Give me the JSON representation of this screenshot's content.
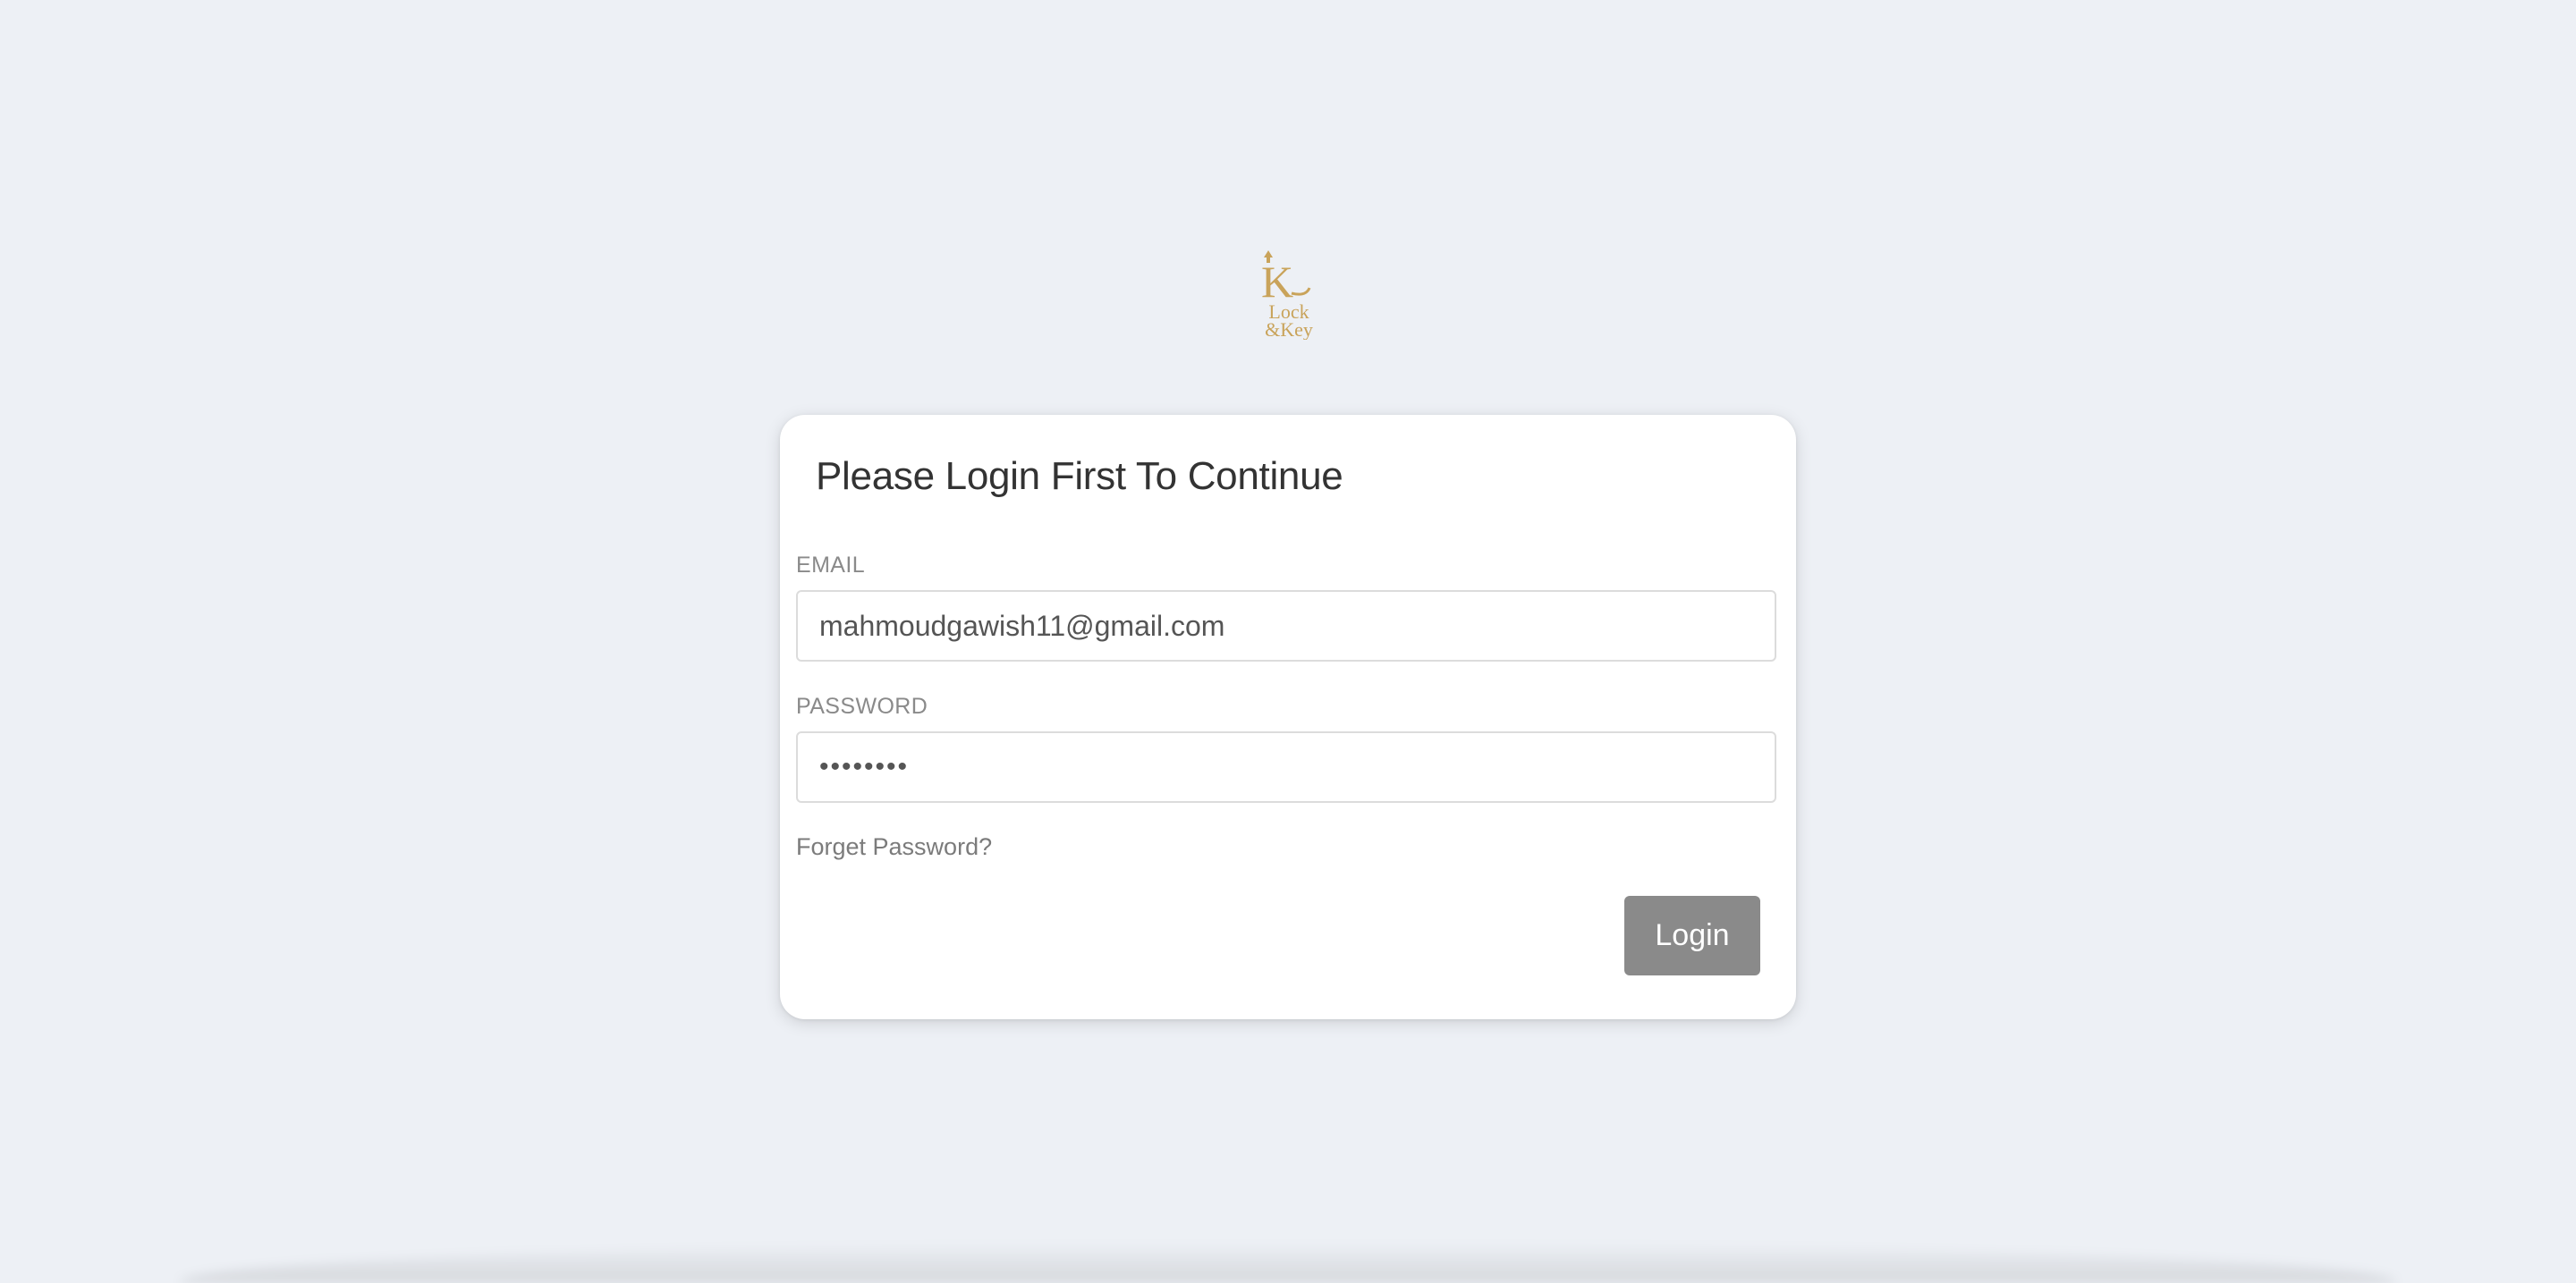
{
  "brand": {
    "logo_text_line1": "Lock",
    "logo_text_line2": "&Key",
    "logo_initial": "K",
    "color": "#c9a35a"
  },
  "login_card": {
    "title": "Please Login First To Continue",
    "email_label": "EMAIL",
    "email_value": "mahmoudgawish11@gmail.com",
    "password_label": "PASSWORD",
    "password_value": "••••••••",
    "forgot_link": "Forget Password?",
    "login_button": "Login"
  },
  "colors": {
    "background": "#edf0f5",
    "button": "#8a8a8a",
    "card": "#ffffff"
  }
}
